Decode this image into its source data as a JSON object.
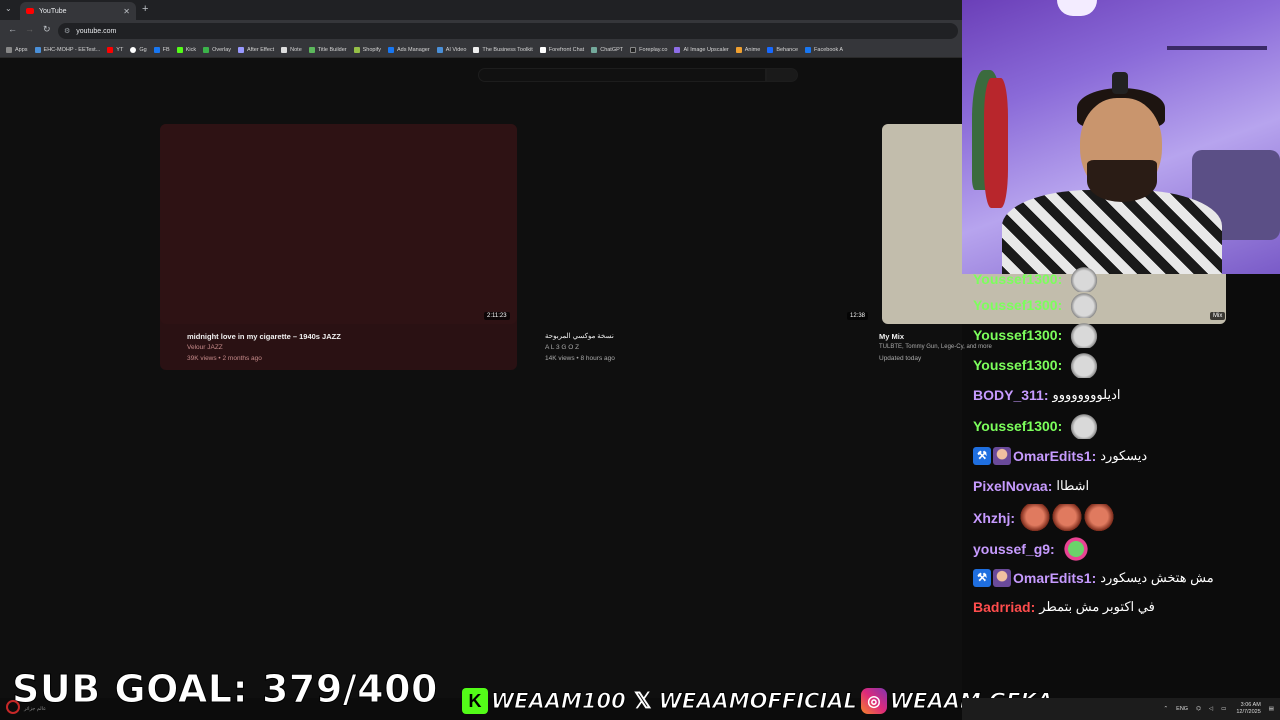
{
  "browser": {
    "tab_title": "YouTube",
    "url": "youtube.com",
    "bookmarks": [
      "Apps",
      "EHC-MOHP - EETest...",
      "YT",
      "Gg",
      "FB",
      "Kick",
      "Overlay",
      "After Effect",
      "Note",
      "Title Builder",
      "Shopify",
      "Ads Manager",
      "AI Video",
      "The Business Toolkit",
      "Forefront Chat",
      "ChatGPT",
      "Foreplay.co",
      "AI Image Upscaler",
      "Anime",
      "Behance",
      "Facebook A"
    ]
  },
  "videos": [
    {
      "duration": "2:11:23",
      "title": "midnight love in my cigarette – 1940s JAZZ",
      "channel": "Velour JAZZ",
      "stats": "39K views • 2 months ago"
    },
    {
      "duration": "12:38",
      "title": "نسخة موكسي المربوحة",
      "channel": "A L 3 G O Z",
      "stats": "14K views • 8 hours ago"
    },
    {
      "badge": "Mix",
      "title": "My Mix",
      "channel": "TULBTE, Tommy Gun, Lege-Cy, and more",
      "stats": "Updated today"
    }
  ],
  "chat": [
    {
      "user": "Youssef1300:",
      "color": "#7cff5c",
      "msg": ""
    },
    {
      "user": "Youssef1300:",
      "color": "#7cff5c",
      "msg": ""
    },
    {
      "user": "Youssef1300:",
      "color": "#7cff5c",
      "msg": ""
    },
    {
      "user": "Youssef1300:",
      "color": "#7cff5c",
      "msg": ""
    },
    {
      "user": "BODY_311:",
      "color": "#c79bff",
      "msg": "اديلوووووووو"
    },
    {
      "user": "Youssef1300:",
      "color": "#7cff5c",
      "msg": ""
    },
    {
      "user": "OmarEdits1:",
      "color": "#c79bff",
      "msg": "ديسكورد"
    },
    {
      "user": "PixelNovaa:",
      "color": "#c79bff",
      "msg": "اشطاا"
    },
    {
      "user": "Xhzhj:",
      "color": "#c79bff",
      "msg": ""
    },
    {
      "user": "youssef_g9:",
      "color": "#c79bff",
      "msg": ""
    },
    {
      "user": "OmarEdits1:",
      "color": "#c79bff",
      "msg": "مش هتخش ديسكورد"
    },
    {
      "user": "Badrriad:",
      "color": "#ff4d4d",
      "msg": "في اكتوبر مش بتمطر"
    }
  ],
  "overlay": {
    "sub_goal": "SUB GOAL: 379/400",
    "kick": "WEAAM100",
    "x": "WEAAMOFFICIAL",
    "instagram": "WEAAM.GEKA"
  },
  "taskbar": {
    "lang": "ENG",
    "time": "3:06 AM",
    "date": "12/7/2025"
  },
  "status_text": "عالم جزائر"
}
